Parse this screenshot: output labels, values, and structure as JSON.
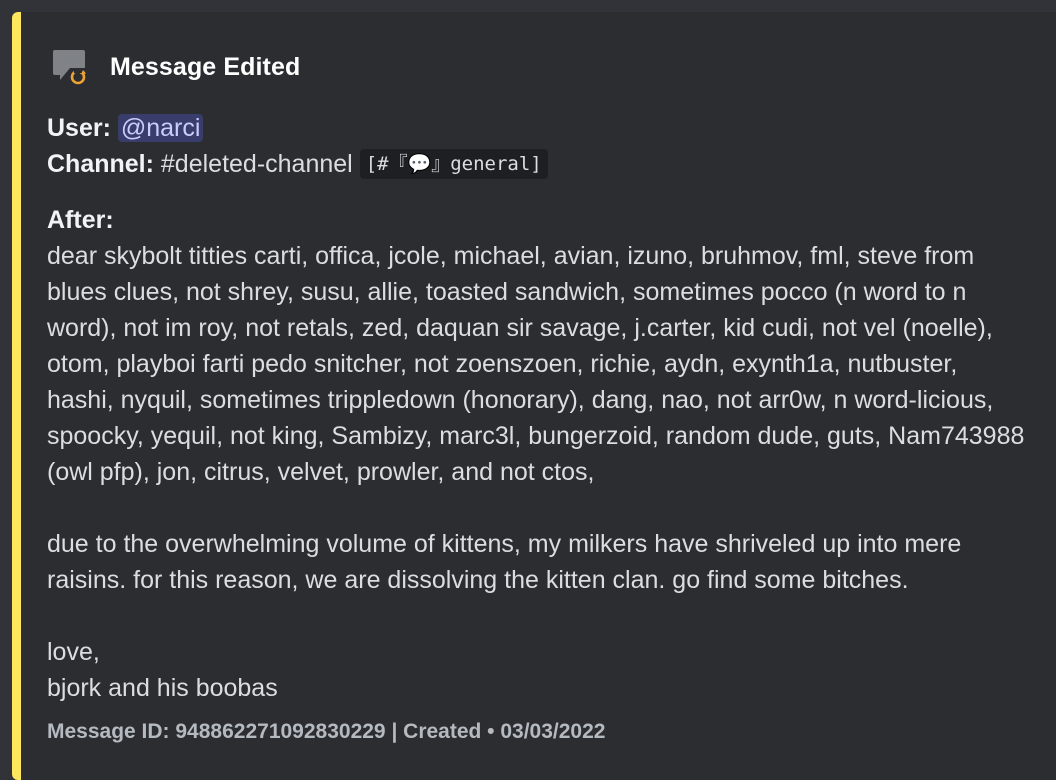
{
  "embed": {
    "accent_color": "#fee75c",
    "author": {
      "icon": "message-edit-icon",
      "title": "Message Edited"
    },
    "fields": {
      "user_label": "User:",
      "user_mention": "@narci",
      "channel_label": "Channel:",
      "channel_name": "#deleted-channel",
      "channel_code": "[#『💬』general]",
      "after_label": "After:",
      "after_text": "dear skybolt titties carti, offica, jcole, michael, avian, izuno, bruhmov, fml, steve from blues clues, not shrey, susu, allie, toasted sandwich, sometimes pocco (n word to n word), not im roy, not retals, zed, daquan sir savage, j.carter, kid cudi, not vel (noelle), otom, playboi farti pedo snitcher, not zoenszoen, richie, aydn, exynth1a, nutbuster, hashi, nyquil, sometimes trippledown (honorary), dang, nao, not arr0w, n word-licious, spoocky, yequil, not king, Sambizy, marc3l, bungerzoid, random dude, guts, Nam743988 (owl pfp), jon, citrus, velvet, prowler, and not ctos,\n\ndue to the overwhelming volume of kittens, my milkers have shriveled up into mere raisins. for this reason, we are dissolving the kitten clan. go find some bitches.\n\nlove,\nbjork and his boobas"
    },
    "footer": "Message ID: 948862271092830229 | Created • 03/03/2022"
  }
}
